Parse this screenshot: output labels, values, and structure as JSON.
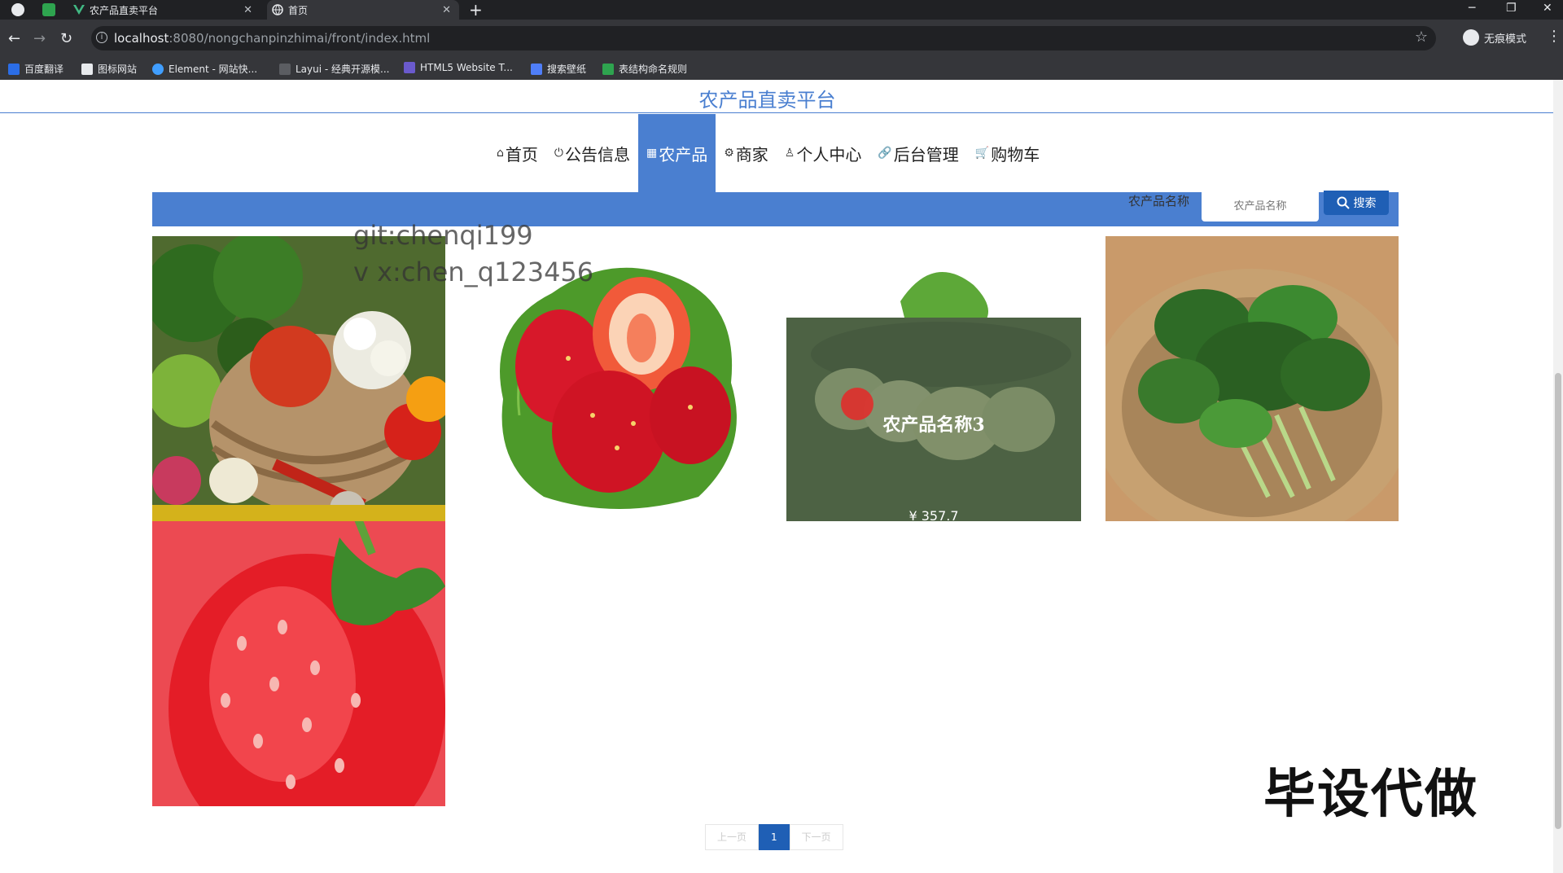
{
  "browser": {
    "tabs": [
      {
        "title": "农产品直卖平台"
      },
      {
        "title": "首页"
      }
    ],
    "url_host": "localhost",
    "url_path": ":8080/nongchanpinzhimai/front/index.html",
    "profile_label": "无痕模式",
    "bookmarks": [
      "百度翻译",
      "图标网站",
      "Element - 网站快...",
      "Layui - 经典开源模...",
      "HTML5 Website T...",
      "搜索壁纸",
      "表结构命名规则"
    ]
  },
  "site": {
    "title": "农产品直卖平台",
    "nav": [
      {
        "label": "首页",
        "icon": "home-icon",
        "glyph": "⌂"
      },
      {
        "label": "公告信息",
        "icon": "power-icon",
        "glyph": "⏻"
      },
      {
        "label": "农产品",
        "icon": "grid-icon",
        "glyph": "▦",
        "active": true
      },
      {
        "label": "商家",
        "icon": "gear-icon",
        "glyph": "⚙"
      },
      {
        "label": "个人中心",
        "icon": "user-icon",
        "glyph": "♙"
      },
      {
        "label": "后台管理",
        "icon": "link-icon",
        "glyph": "🔗"
      },
      {
        "label": "购物车",
        "icon": "cart-icon",
        "glyph": "🛒"
      }
    ],
    "accent_color": "#4a7fd0",
    "button_color": "#1f5fb5"
  },
  "search": {
    "label": "农产品名称",
    "placeholder": "农产品名称",
    "button_label": "搜索"
  },
  "watermark": {
    "line1": "git:chenqi199",
    "line2": "v x:chen_q123456"
  },
  "products": [
    {
      "image": "vegetable-basket"
    },
    {
      "image": "strawberries-on-leaf"
    },
    {
      "image": "cucumber-slices",
      "hover_name": "农产品名称3",
      "hover_price": "¥ 357.7"
    },
    {
      "image": "spinach-basket"
    },
    {
      "image": "strawberry-closeup"
    }
  ],
  "pagination": {
    "prev": "上一页",
    "current": "1",
    "next": "下一页"
  },
  "overlay_stamp": "毕设代做"
}
